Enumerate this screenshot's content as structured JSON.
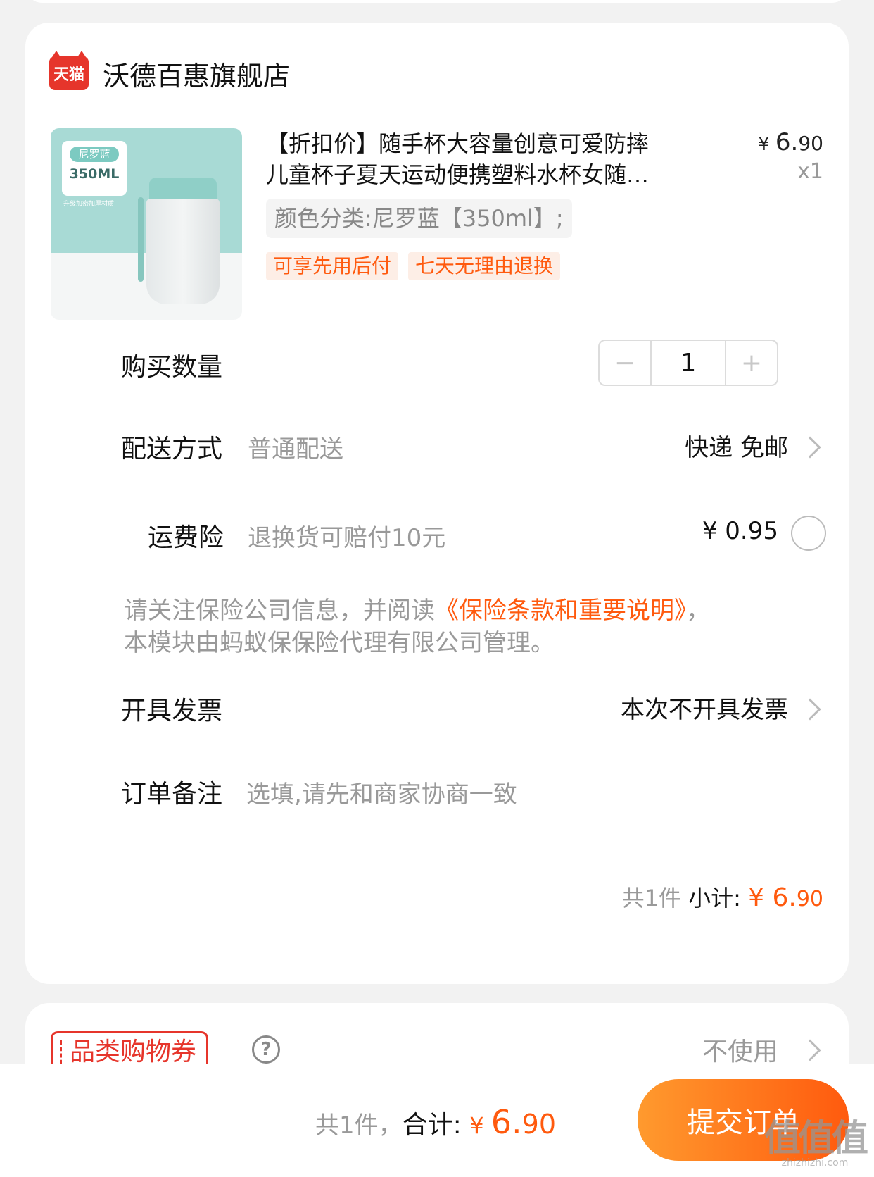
{
  "shop": {
    "badge": "天猫",
    "name": "沃德百惠旗舰店"
  },
  "product": {
    "image_badge": "尼罗蓝",
    "image_size": "350ML",
    "image_caption": "升级加密加厚材质",
    "title_line1": "【折扣价】随手杯大容量创意可爱防摔",
    "title_line2": "儿童杯子夏天运动便携塑料水杯女随…",
    "price_yen": "¥ ",
    "price_int": "6.",
    "price_dec": "90",
    "quantity": "x1",
    "sku": "颜色分类:尼罗蓝【350ml】;",
    "tags": [
      "可享先用后付",
      "七天无理由退换"
    ]
  },
  "quantity_row": {
    "label": "购买数量",
    "minus": "−",
    "value": "1",
    "plus": "+"
  },
  "delivery_row": {
    "label": "配送方式",
    "sub": "普通配送",
    "value": "快递 免邮"
  },
  "insurance_row": {
    "label": "运费险",
    "sub": "退换货可赔付10元",
    "price": "¥ 0.95"
  },
  "notice": {
    "prefix": "请关注保险公司信息，并阅读",
    "link": "《保险条款和重要说明》",
    "suffix": "，本模块由蚂蚁保保险代理有限公司管理。"
  },
  "invoice_row": {
    "label": "开具发票",
    "value": "本次不开具发票"
  },
  "remark_row": {
    "label": "订单备注",
    "placeholder": "选填,请先和商家协商一致"
  },
  "subtotal": {
    "count": "共1件 ",
    "label": "小计: ",
    "yen": "¥ ",
    "int": "6.",
    "dec": "90"
  },
  "coupon": {
    "label": "品类购物券",
    "help": "?",
    "value": "不使用"
  },
  "bottom_bar": {
    "count": "共1件，",
    "label": "合计: ",
    "yen": "¥ ",
    "int": "6.",
    "dec": "90",
    "submit": "提交订单"
  },
  "watermark": {
    "mark": "值值值",
    "site": "zhizhizhi.com"
  },
  "colors": {
    "accent": "#ff5a0e",
    "tmall_red": "#e6352b",
    "mint": "#a8dad5"
  }
}
